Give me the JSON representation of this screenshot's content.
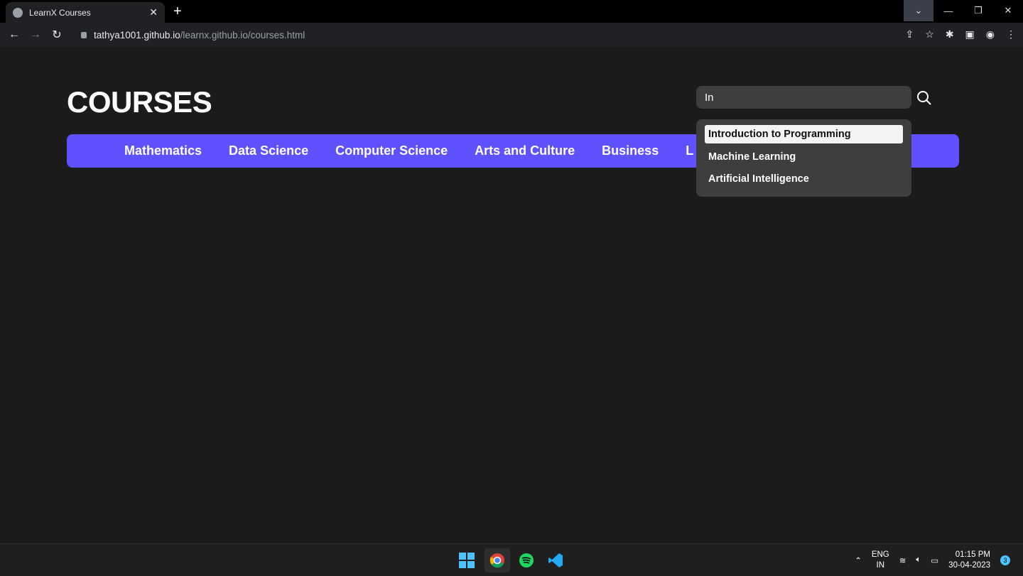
{
  "browser": {
    "tab_title": "LearnX Courses",
    "url_host": "tathya1001.github.io",
    "url_path": "/learnx.github.io/courses.html"
  },
  "page": {
    "title": "COURSES",
    "nav": [
      "Mathematics",
      "Data Science",
      "Computer Science",
      "Arts and Culture",
      "Business",
      "L"
    ],
    "search": {
      "value": "In"
    },
    "suggestions": [
      "Introduction to Programming",
      "Machine Learning",
      "Artificial Intelligence"
    ],
    "accent": "#6051ff"
  },
  "taskbar": {
    "lang1": "ENG",
    "lang2": "IN",
    "time": "01:15 PM",
    "date": "30-04-2023",
    "notifications": "3"
  }
}
